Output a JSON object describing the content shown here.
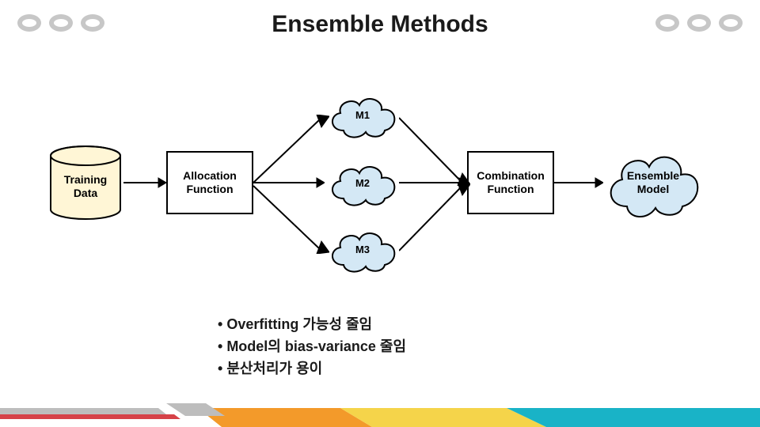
{
  "title": "Ensemble Methods",
  "diagram": {
    "training_data": "Training\nData",
    "allocation_function": "Allocation\nFunction",
    "models": {
      "m1": "M1",
      "m2": "M2",
      "m3": "M3"
    },
    "combination_function": "Combination\nFunction",
    "ensemble_model": "Ensemble\nModel"
  },
  "bullets": [
    "Overfitting 가능성 줄임",
    "Model의 bias-variance 줄임",
    "분산처리가 용이"
  ],
  "colors": {
    "ring": "#c7c7c7",
    "cylinder_fill": "#fff6d6",
    "cloud_fill": "#d4e8f5",
    "footer_orange": "#f39a2a",
    "footer_red": "#d64248",
    "footer_yellow": "#f5d44a",
    "footer_teal": "#19b3c7",
    "footer_grey": "#bdbdbd"
  }
}
